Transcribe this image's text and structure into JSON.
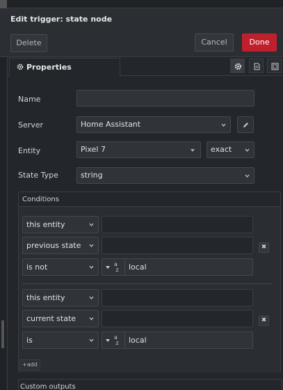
{
  "dialog": {
    "title": "Edit trigger: state node",
    "buttons": {
      "delete": "Delete",
      "cancel": "Cancel",
      "done": "Done"
    },
    "colors": {
      "done": "#c0202d",
      "background": "#23262a"
    }
  },
  "tabs": {
    "properties": "Properties",
    "icons": [
      "gear-icon",
      "description-icon",
      "appearance-icon"
    ]
  },
  "form": {
    "name": {
      "label": "Name",
      "value": ""
    },
    "server": {
      "label": "Server",
      "value": "Home Assistant"
    },
    "entity": {
      "label": "Entity",
      "value": "Pixel 7",
      "match": "exact"
    },
    "state_type": {
      "label": "State Type",
      "value": "string"
    }
  },
  "conditions": {
    "label": "Conditions",
    "groups": [
      {
        "rows": [
          {
            "select": "this entity",
            "value": ""
          },
          {
            "select": "previous state",
            "value": ""
          },
          {
            "select": "is not",
            "value": "local",
            "type_icon": "az"
          }
        ]
      },
      {
        "rows": [
          {
            "select": "this entity",
            "value": ""
          },
          {
            "select": "current state",
            "value": ""
          },
          {
            "select": "is",
            "value": "local",
            "type_icon": "az"
          }
        ]
      }
    ],
    "remove_label": "✖",
    "add_label": "+add"
  },
  "outputs": {
    "label": "Custom outputs"
  }
}
